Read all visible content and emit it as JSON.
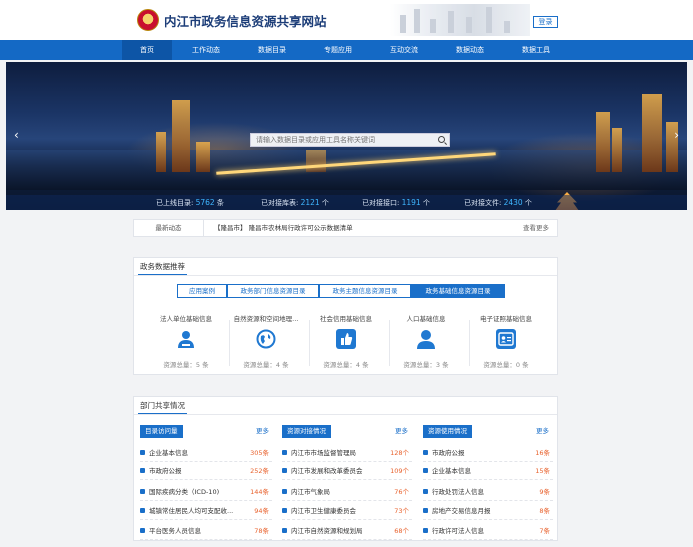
{
  "header": {
    "site_title": "内江市政务信息资源共享网站",
    "login_label": "登录"
  },
  "nav": {
    "items": [
      "首页",
      "工作动态",
      "数据目录",
      "专题应用",
      "互动交流",
      "数据动态",
      "数据工具"
    ],
    "active_index": 0
  },
  "banner": {
    "search_placeholder": "请输入数据目录或应用工具名称关键词",
    "stats": [
      {
        "label": "已上线目录:",
        "value": "5762",
        "unit": "条"
      },
      {
        "label": "已对接库表:",
        "value": "2121",
        "unit": "个"
      },
      {
        "label": "已对接接口:",
        "value": "1191",
        "unit": "个"
      },
      {
        "label": "已对接文件:",
        "value": "2430",
        "unit": "个"
      }
    ]
  },
  "news": {
    "label": "最新动态",
    "headline": "【隆昌市】 隆昌市农林局行政许可公示数据清单",
    "more": "查看更多"
  },
  "recommend": {
    "title": "政务数据推荐",
    "tabs": [
      "应用案例",
      "政务部门信息资源目录",
      "政务主题信息资源目录",
      "政务基础信息资源目录"
    ],
    "active_tab": 3,
    "categories": [
      {
        "name": "法人单位基础信息",
        "count": "资源总量：5 条",
        "icon": "person-icon"
      },
      {
        "name": "自然资源和空间地理...",
        "count": "资源总量：4 条",
        "icon": "globe-icon"
      },
      {
        "name": "社会信用基础信息",
        "count": "资源总量：4 条",
        "icon": "thumbs-up-icon"
      },
      {
        "name": "人口基础信息",
        "count": "资源总量：3 条",
        "icon": "user-icon"
      },
      {
        "name": "电子证照基础信息",
        "count": "资源总量：0 条",
        "icon": "id-card-icon"
      }
    ],
    "colors": {
      "accent": "#1a6fc9",
      "icon_blue": "#1f78d1"
    }
  },
  "sharing": {
    "title": "部门共享情况",
    "more_label": "更多",
    "columns": [
      {
        "heading": "目录访问量",
        "rows": [
          {
            "name": "企业基本信息",
            "count": "305条"
          },
          {
            "name": "市政府公报",
            "count": "252条"
          },
          {
            "name": "国际疾病分类（ICD-10)",
            "count": "144条"
          },
          {
            "name": "城镇常住居民人均可支配收...",
            "count": "94条"
          },
          {
            "name": "平台医务人员信息",
            "count": "78条"
          }
        ]
      },
      {
        "heading": "资源对接情况",
        "rows": [
          {
            "name": "内江市市场监督管理局",
            "count": "128个"
          },
          {
            "name": "内江市发展和改革委员会",
            "count": "109个"
          },
          {
            "name": "内江市气象局",
            "count": "76个"
          },
          {
            "name": "内江市卫生健康委员会",
            "count": "73个"
          },
          {
            "name": "内江市自然资源和规划局",
            "count": "68个"
          }
        ]
      },
      {
        "heading": "资源使用情况",
        "rows": [
          {
            "name": "市政府公报",
            "count": "16条"
          },
          {
            "name": "企业基本信息",
            "count": "15条"
          },
          {
            "name": "行政处罚法人信息",
            "count": "9条"
          },
          {
            "name": "房地产交易信息月报",
            "count": "8条"
          },
          {
            "name": "行政许可法人信息",
            "count": "7条"
          }
        ]
      }
    ]
  }
}
